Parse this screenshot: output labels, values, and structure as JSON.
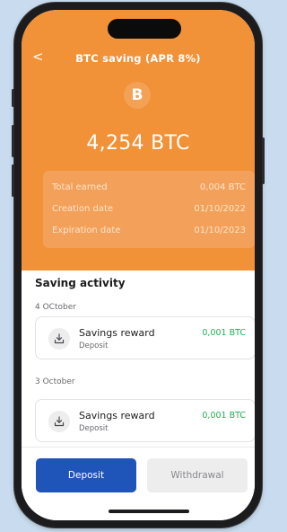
{
  "header": {
    "back_glyph": "<",
    "title": "BTC saving (APR 8%)",
    "coin_glyph": "B",
    "balance": "4,254 BTC"
  },
  "info": {
    "rows": [
      {
        "label": "Total earned",
        "value": "0,004 BTC"
      },
      {
        "label": "Creation date",
        "value": "01/10/2022"
      },
      {
        "label": "Expiration date",
        "value": "01/10/2023"
      }
    ]
  },
  "activity": {
    "title": "Saving activity",
    "groups": [
      {
        "date": "4 OCtober",
        "item": {
          "name": "Savings reward",
          "type": "Deposit",
          "amount": "0,001 BTC"
        }
      },
      {
        "date": "3 October",
        "item": {
          "name": "Savings reward",
          "type": "Deposit",
          "amount": "0,001 BTC"
        }
      }
    ]
  },
  "actions": {
    "deposit_label": "Deposit",
    "withdrawal_label": "Withdrawal"
  },
  "colors": {
    "header": "#f19138",
    "accent_blue": "#1f55b8",
    "positive": "#1fae55"
  },
  "icons": {
    "back": "chevron-left-icon",
    "coin": "bitcoin-icon",
    "activity": "download-icon"
  }
}
